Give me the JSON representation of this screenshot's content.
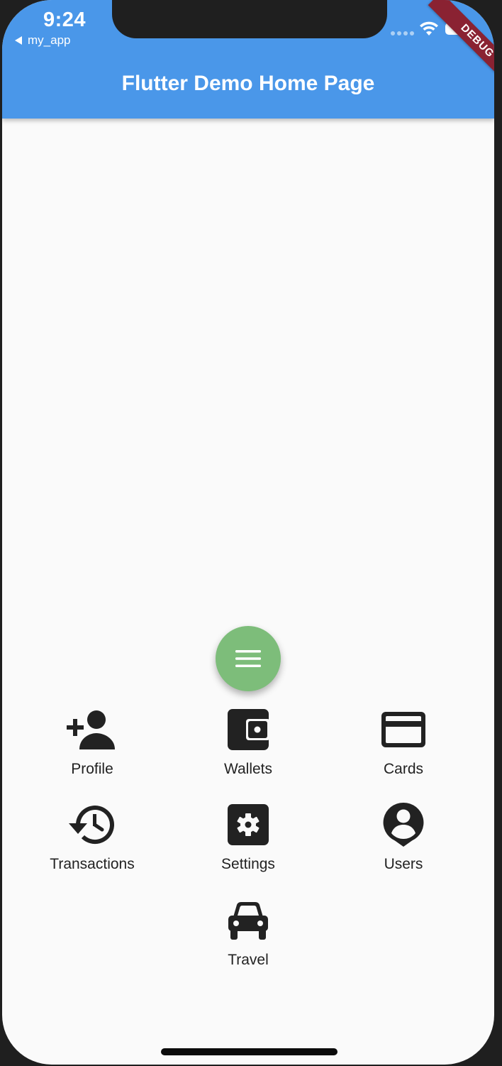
{
  "status_bar": {
    "time": "9:24",
    "back_app": "my_app",
    "debug_label": "DEBUG"
  },
  "app_bar": {
    "title": "Flutter Demo Home Page",
    "color": "#4a97e9"
  },
  "fab": {
    "icon": "menu-icon",
    "color": "#7dbd7a"
  },
  "menu": {
    "items": [
      {
        "label": "Profile",
        "icon": "person-add-icon"
      },
      {
        "label": "Wallets",
        "icon": "wallet-icon"
      },
      {
        "label": "Cards",
        "icon": "credit-card-icon"
      },
      {
        "label": "Transactions",
        "icon": "history-icon"
      },
      {
        "label": "Settings",
        "icon": "settings-icon"
      },
      {
        "label": "Users",
        "icon": "user-pin-icon"
      },
      {
        "label": "Travel",
        "icon": "car-icon"
      }
    ]
  }
}
